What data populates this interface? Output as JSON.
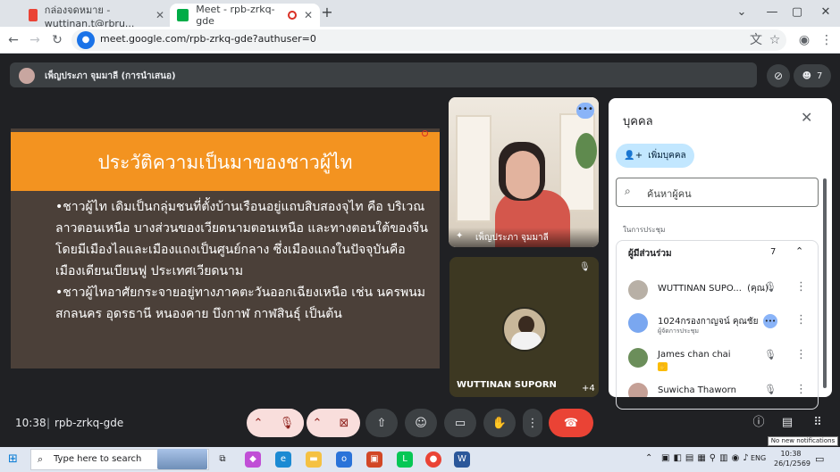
{
  "browser": {
    "tabs": [
      {
        "title": "กล่องจดหมาย - wuttinan.t@rbru...",
        "close": "✕"
      },
      {
        "title": "Meet - rpb-zrkq-gde",
        "close": "✕"
      }
    ],
    "new_tab": "+",
    "window_buttons": [
      "⌄",
      "—",
      "▢",
      "✕"
    ],
    "url": "meet.google.com/rpb-zrkq-gde?authuser=0"
  },
  "presentation": {
    "presenter_label": "เพ็ญประภา จุมมาลี (การนำเสนอ)",
    "people_count": "7"
  },
  "slide": {
    "title": "ประวัติความเป็นมาของชาวผู้ไท",
    "bullet1": "•ชาวผู้ไท เดิมเป็นกลุ่มชนที่ตั้งบ้านเรือนอยู่แถบสิบสองจุไท คือ บริเวณลาวตอนเหนือ บางส่วนของเวียดนามตอนเหนือ และทางตอนใต้ของจีน โดยมีเมืองไลและเมืองแถงเป็นศูนย์กลาง ซึ่งเมืองแถงในปัจจุบันคือเมืองเดียนเบียนฟู ประเทศเวียดนาม",
    "bullet2": "•ชาวผู้ไทอาศัยกระจายอยู่ทางภาคตะวันออกเฉียงเหนือ เช่น นครพนม สกลนคร อุดรธานี หนองคาย บึงกาฬ กาฬสินธุ์ เป็นต้น"
  },
  "tiles": {
    "speaker_name": "เพ็ญประภา จุมมาลี",
    "self_name": "WUTTINAN SUPORN",
    "others_count": "+4"
  },
  "people_panel": {
    "title": "บุคคล",
    "add_label": "เพิ่มบุคคล",
    "search_placeholder": "ค้นหาผู้คน",
    "section_label": "ในการประชุม",
    "group_label": "ผู้มีส่วนร่วม",
    "group_count": "7",
    "participants": [
      {
        "name": "WUTTINAN SUPO...",
        "suffix": "(คุณ)",
        "sub": "",
        "color": "#9aa0a6"
      },
      {
        "name": "1024กรองกาญจน์ คุณชัย",
        "suffix": "",
        "sub": "ผู้จัดการประชุม",
        "color": "#8ab4f8"
      },
      {
        "name": "James chan chai",
        "suffix": "",
        "sub": "",
        "color": "#6b8e5a"
      },
      {
        "name": "Suwicha Thaworn",
        "suffix": "",
        "sub": "",
        "color": "#c5a096"
      }
    ]
  },
  "controls": {
    "time": "10:38",
    "meeting_code": "rpb-zrkq-gde",
    "tooltip": "No new notifications"
  },
  "taskbar": {
    "search_placeholder": "Type here to search",
    "language": "ENG",
    "time": "10:38",
    "date": "26/1/2569"
  }
}
